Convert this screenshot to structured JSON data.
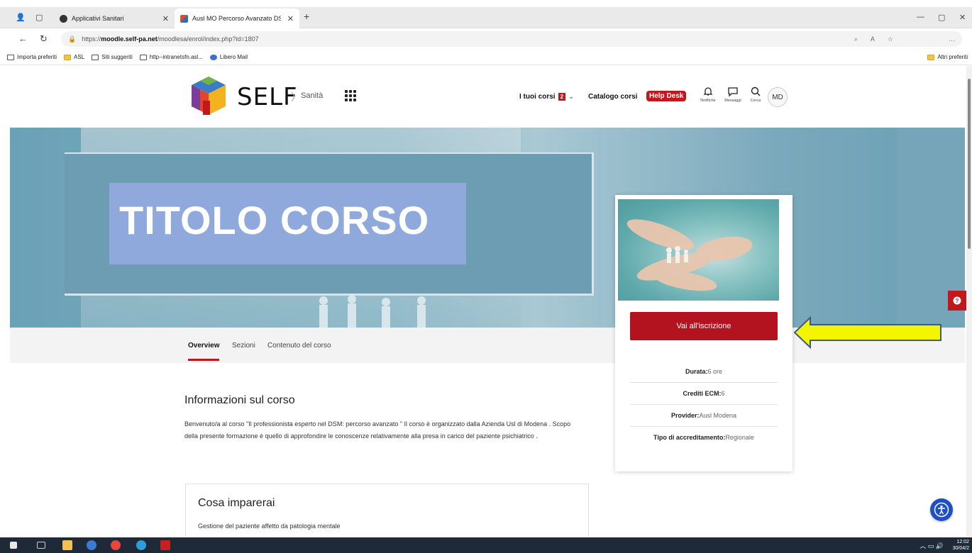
{
  "browser": {
    "tabs": [
      {
        "title": "Applicativi Sanitari"
      },
      {
        "title": "Ausl MO Percorso Avanzato DSM"
      }
    ],
    "new_tab": "+",
    "url_prefix": "https://",
    "url_host": "moodle.self-pa.net",
    "url_path": "/moodlesa/enrol/index.php?id=1807",
    "bookmarks": [
      "Importa preferiti",
      "ASL",
      "Siti suggeriti",
      "http--intranetsfn.asl...",
      "Libero Mail"
    ],
    "bookmarks_other": "Altri preferiti"
  },
  "header": {
    "brand": "SELF",
    "separator": "〉",
    "subtitle": "Sanità",
    "nav_my_courses": "I tuoi corsi",
    "my_courses_count": "2",
    "nav_catalog": "Catalogo corsi",
    "nav_help": "Help Desk",
    "notifications_label": "Notifiche",
    "messages_label": "Messaggi",
    "search_label": "Cerca",
    "avatar_initials": "MD"
  },
  "hero": {
    "title": "TITOLO CORSO"
  },
  "course_tabs": [
    "Overview",
    "Sezioni",
    "Contenuto del corso"
  ],
  "info": {
    "heading": "Informazioni sul corso",
    "body": "Benvenuto/a al corso \"Il professionista esperto nel DSM: percorso avanzato \" Il corso è organizzato dalla Azienda Usl di Modena . Scopo della presente formazione è quello di approfondire le conoscenze relativamente alla presa in carico del paziente psichiatrico ."
  },
  "learn": {
    "heading": "Cosa imparerai",
    "item": "Gestione del paziente affetto da patologia mentale"
  },
  "card": {
    "enroll_button": "Vai all'iscrizione",
    "details": [
      {
        "label": "Durata:",
        "value": "6 ore"
      },
      {
        "label": "Crediti ECM:",
        "value": "6"
      },
      {
        "label": "Provider:",
        "value": "Ausl Modena"
      },
      {
        "label": "Tipo di accreditamento:",
        "value": "Regionale"
      }
    ]
  },
  "taskbar": {
    "time": "12:02",
    "date": "30/04/2"
  },
  "colors": {
    "brand_red": "#c2171b",
    "enroll_red": "#b3131f",
    "hero_blue": "#6c9db2",
    "title_box": "#8fa9dc",
    "annotation_yellow": "#f5f500",
    "accessibility_blue": "#1f4fc4"
  }
}
